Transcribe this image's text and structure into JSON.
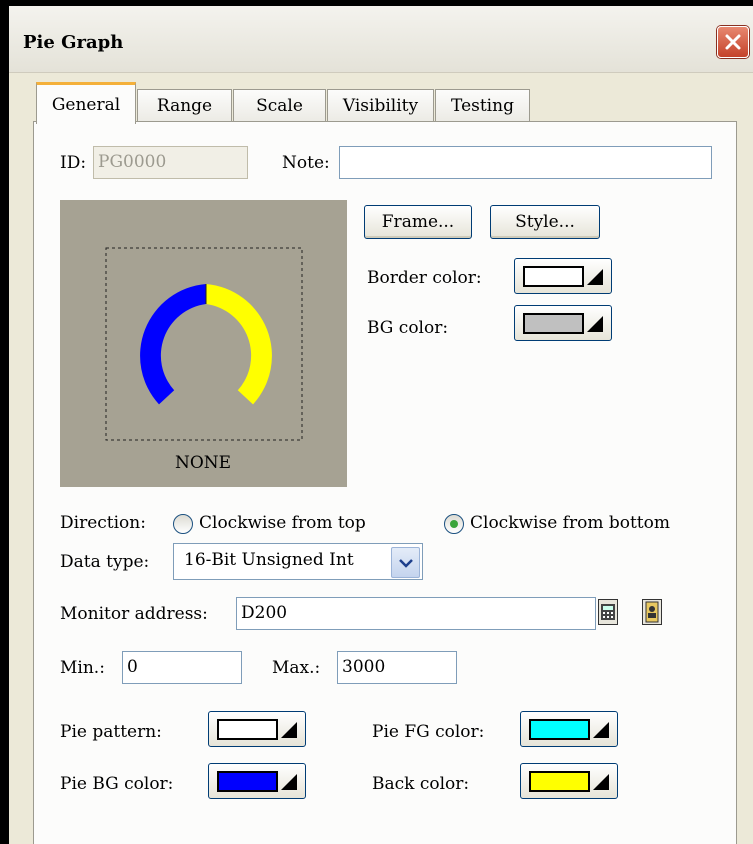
{
  "window": {
    "title": "Pie Graph"
  },
  "tabs": [
    {
      "label": "General",
      "active": true
    },
    {
      "label": "Range"
    },
    {
      "label": "Scale"
    },
    {
      "label": "Visibility"
    },
    {
      "label": "Testing"
    }
  ],
  "general": {
    "id_label": "ID:",
    "id_value": "PG0000",
    "note_label": "Note:",
    "note_value": "",
    "frame_button": "Frame...",
    "style_button": "Style...",
    "border_color_label": "Border color:",
    "border_color": "#ffffff",
    "bg_color_label": "BG color:",
    "bg_color": "#c0c0c0",
    "preview_caption": "NONE",
    "preview_colors": {
      "background": "#a6a293",
      "pie_bg": "#0000ff",
      "back": "#ffff00"
    },
    "direction_label": "Direction:",
    "direction_options": [
      {
        "label": "Clockwise from top",
        "selected": false
      },
      {
        "label": "Clockwise from bottom",
        "selected": true
      }
    ],
    "data_type_label": "Data type:",
    "data_type_value": "16-Bit Unsigned Int",
    "monitor_address_label": "Monitor address:",
    "monitor_address_value": "D200",
    "min_label": "Min.:",
    "min_value": "0",
    "max_label": "Max.:",
    "max_value": "3000",
    "pie_pattern_label": "Pie pattern:",
    "pie_pattern_color": "#ffffff",
    "pie_fg_color_label": "Pie FG color:",
    "pie_fg_color": "#00ffff",
    "pie_bg_color_label": "Pie BG color:",
    "pie_bg_color": "#0000ff",
    "back_color_label": "Back color:",
    "back_color": "#ffff00"
  },
  "icons": {
    "close": "close-icon",
    "calculator": "calculator-icon",
    "address_book": "address-book-icon",
    "dropdown": "chevron-down-icon"
  }
}
